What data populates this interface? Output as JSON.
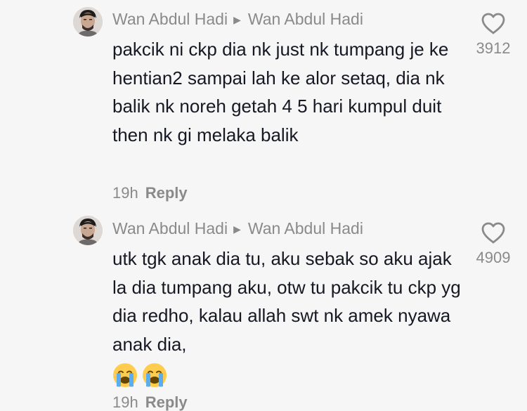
{
  "comments": [
    {
      "author": "Wan Abdul Hadi",
      "reply_to": "Wan Abdul Hadi",
      "text": "pakcik ni ckp dia nk just nk tumpang je ke hentian2 sampai lah ke alor setaq, dia nk balik nk noreh getah 4 5 hari kumpul duit then nk gi melaka balik",
      "time": "19h",
      "reply_label": "Reply",
      "likes": "3912"
    },
    {
      "author": "Wan Abdul Hadi",
      "reply_to": "Wan Abdul Hadi",
      "text": "utk tgk anak dia tu, aku sebak so aku ajak la dia tumpang aku, otw tu pakcik tu ckp yg dia redho, kalau allah swt nk amek nyawa anak dia,",
      "emojis": [
        "loudly-crying-face",
        "loudly-crying-face"
      ],
      "time": "19h",
      "reply_label": "Reply",
      "likes": "4909"
    }
  ],
  "colors": {
    "background": "#f6f6f6",
    "text_primary": "#161823",
    "text_secondary": "#8a8a8a",
    "emoji_yellow": "#ffcc4d",
    "emoji_tears": "#5dadec"
  }
}
